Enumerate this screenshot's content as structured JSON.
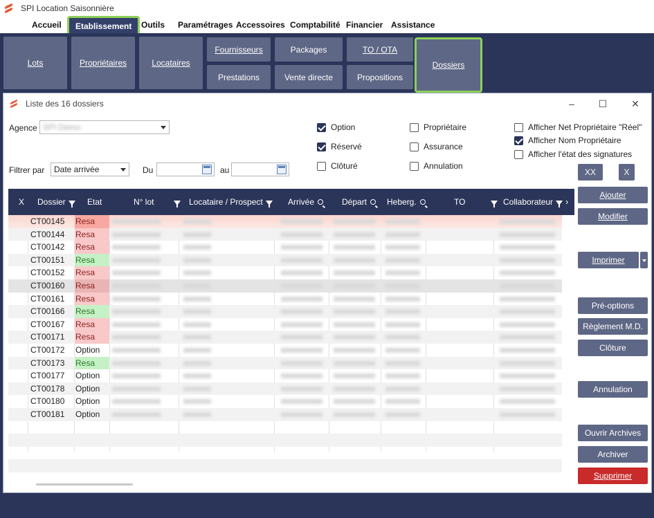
{
  "app": {
    "title": "SPI Location Saisonnière"
  },
  "menu": [
    "Accueil",
    "Etablissement",
    "Outils",
    "Paramétrages",
    "Accessoires",
    "Comptabilité",
    "Financier",
    "Assistance"
  ],
  "ribbon": {
    "lots": "Lots",
    "proprietaires": "Propriétaires",
    "locataires": "Locataires",
    "fournisseurs": "Fournisseurs",
    "prestations": "Prestations",
    "packages": "Packages",
    "vente_directe": "Vente directe",
    "to_ota": "TO / OTA",
    "propositions": "Propositions",
    "dossiers": "Dossiers"
  },
  "dialog": {
    "title": "Liste des 16 dossiers",
    "agence_label": "Agence",
    "agence_value": "SPI Demo",
    "filtrer_label": "Filtrer par",
    "filtrer_value": "Date arrivée",
    "du_label": "Du",
    "au_label": "au",
    "checkboxes": {
      "option": {
        "label": "Option",
        "checked": true
      },
      "reserve": {
        "label": "Réservé",
        "checked": true
      },
      "cloture": {
        "label": "Clôturé",
        "checked": false
      },
      "proprietaire": {
        "label": "Propriétaire",
        "checked": false
      },
      "assurance": {
        "label": "Assurance",
        "checked": false
      },
      "annulation": {
        "label": "Annulation",
        "checked": false
      },
      "afficher_net": {
        "label": "Afficher Net Propriétaire \"Réel\"",
        "checked": false
      },
      "afficher_nom": {
        "label": "Afficher Nom Propriétaire",
        "checked": true
      },
      "afficher_etat": {
        "label": "Afficher l'état des signatures",
        "checked": false
      }
    },
    "buttons": {
      "xx": "XX",
      "x": "X",
      "ajouter": "Ajouter",
      "modifier": "Modifier",
      "imprimer": "Imprimer",
      "preoptions": "Pré-options",
      "reglement": "Règlement M.D.",
      "cloture": "Clôture",
      "annulation": "Annulation",
      "ouvrir_archives": "Ouvrir Archives",
      "archiver": "Archiver",
      "supprimer": "Supprimer"
    }
  },
  "grid": {
    "columns": [
      "X",
      "Dossier",
      "Etat",
      "N° lot",
      "Locataire / Prospect",
      "Arrivée",
      "Départ",
      "Heberg.",
      "TO",
      "Collaborateur"
    ],
    "rows": [
      {
        "dossier": "CT00145",
        "etat": "Resa",
        "color": "#f7a8a0"
      },
      {
        "dossier": "CT00144",
        "etat": "Resa",
        "color": "#f9c9c9"
      },
      {
        "dossier": "CT00142",
        "etat": "Resa",
        "color": "#f9c9c9"
      },
      {
        "dossier": "CT00151",
        "etat": "Resa",
        "color": "#c6f0c6"
      },
      {
        "dossier": "CT00152",
        "etat": "Resa",
        "color": "#f9c9c9"
      },
      {
        "dossier": "CT00160",
        "etat": "Resa",
        "color": "#e9b4b4"
      },
      {
        "dossier": "CT00161",
        "etat": "Resa",
        "color": "#f9c9c9"
      },
      {
        "dossier": "CT00166",
        "etat": "Resa",
        "color": "#c6f0c6"
      },
      {
        "dossier": "CT00167",
        "etat": "Resa",
        "color": "#f9c9c9"
      },
      {
        "dossier": "CT00171",
        "etat": "Resa",
        "color": "#f9c9c9"
      },
      {
        "dossier": "CT00172",
        "etat": "Option",
        "color": ""
      },
      {
        "dossier": "CT00173",
        "etat": "Resa",
        "color": "#c6f0c6"
      },
      {
        "dossier": "CT00177",
        "etat": "Option",
        "color": ""
      },
      {
        "dossier": "CT00178",
        "etat": "Option",
        "color": ""
      },
      {
        "dossier": "CT00180",
        "etat": "Option",
        "color": ""
      },
      {
        "dossier": "CT00181",
        "etat": "Option",
        "color": ""
      }
    ]
  },
  "colors": {
    "accent": "#2b3559",
    "button": "#5e6785",
    "highlight": "#8ed05a",
    "danger": "#c92a2a"
  }
}
